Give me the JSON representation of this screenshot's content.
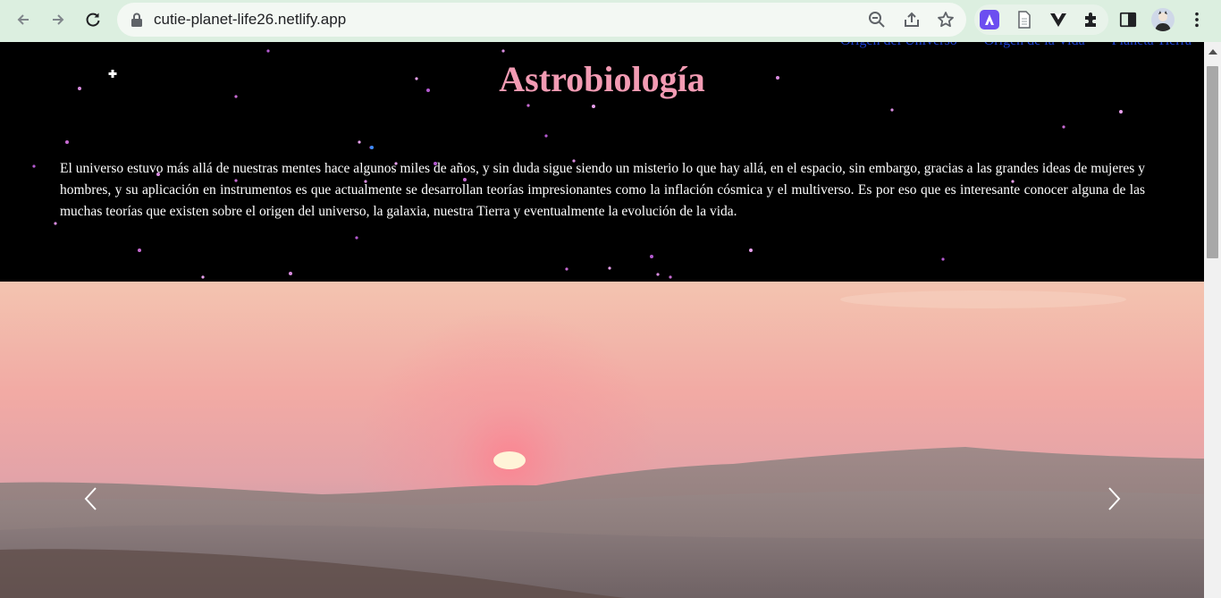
{
  "browser": {
    "url": "cutie-planet-life26.netlify.app"
  },
  "nav": {
    "links": [
      {
        "label": "Origen del Universo"
      },
      {
        "label": "Origen de la Vida"
      },
      {
        "label": "Planeta Tierra"
      }
    ]
  },
  "page": {
    "title": "Astrobiología",
    "intro": "El universo estuvo más allá de nuestras mentes hace algunos miles de años, y sin duda sigue siendo un misterio lo que hay allá, en el espacio, sin embargo, gracias a las grandes ideas de mujeres y hombres, y su aplicación en instrumentos es que actualmente se desarrollan teorías impresionantes como la inflación cósmica y el multiverso. Es por eso que es interesante conocer alguna de las muchas teorías que existen sobre el origen del universo, la galaxia, nuestra Tierra y eventualmente la evolución de la vida."
  },
  "carousel": {
    "image_description": "desert-sunset",
    "prev_icon": "chevron-left-icon",
    "next_icon": "chevron-right-icon"
  },
  "colors": {
    "title": "#f29bb3",
    "nav_link": "#1a3fd6",
    "background": "#000000",
    "chrome": "#dcefe0"
  }
}
